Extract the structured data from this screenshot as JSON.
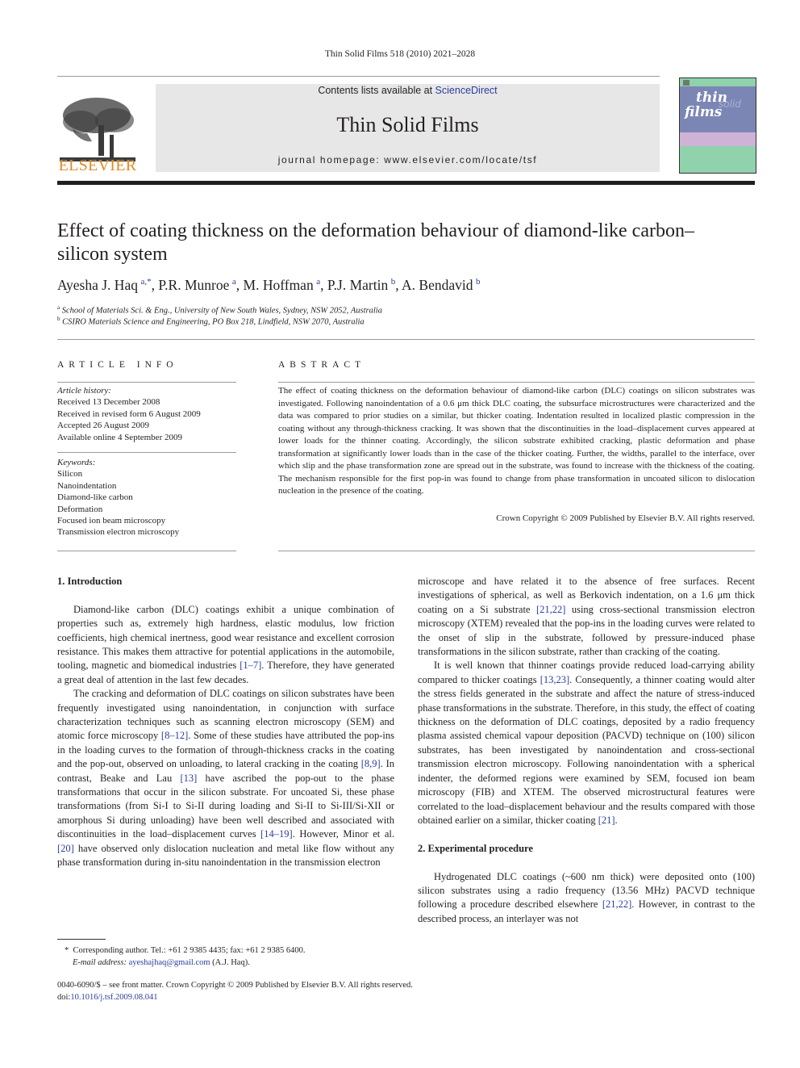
{
  "running_head": "Thin Solid Films 518 (2010) 2021–2028",
  "masthead": {
    "publisher_logo_text": "ELSEVIER",
    "contents_prefix": "Contents lists available at ",
    "contents_link": "ScienceDirect",
    "journal_name": "Thin Solid Films",
    "homepage": "journal homepage: www.elsevier.com/locate/tsf",
    "cover": {
      "word1": "thin",
      "word2": "solid",
      "word3": "films"
    }
  },
  "colors": {
    "link": "#2b3d9b",
    "elsevier_orange": "#e08b2a",
    "masthead_bg": "#e7e7e8",
    "cover_green": "#8fd2ac",
    "cover_blue": "#7c86b5",
    "cover_pink": "#cfb3d6"
  },
  "article": {
    "title": "Effect of coating thickness on the deformation behaviour of diamond-like carbon–silicon system",
    "authors": [
      {
        "name": "Ayesha J. Haq",
        "sup": "a,*"
      },
      {
        "name": "P.R. Munroe",
        "sup": "a"
      },
      {
        "name": "M. Hoffman",
        "sup": "a"
      },
      {
        "name": "P.J. Martin",
        "sup": "b"
      },
      {
        "name": "A. Bendavid",
        "sup": "b"
      }
    ],
    "affiliations": [
      {
        "sup": "a",
        "text": "School of Materials Sci. & Eng., University of New South Wales, Sydney, NSW 2052, Australia"
      },
      {
        "sup": "b",
        "text": "CSIRO Materials Science and Engineering, PO Box 218, Lindfield, NSW 2070, Australia"
      }
    ]
  },
  "article_info": {
    "heading": "ARTICLE INFO",
    "history_label": "Article history:",
    "history": [
      "Received 13 December 2008",
      "Received in revised form 6 August 2009",
      "Accepted 26 August 2009",
      "Available online 4 September 2009"
    ],
    "keywords_label": "Keywords:",
    "keywords": [
      "Silicon",
      "Nanoindentation",
      "Diamond-like carbon",
      "Deformation",
      "Focused ion beam microscopy",
      "Transmission electron microscopy"
    ]
  },
  "abstract": {
    "heading": "ABSTRACT",
    "text": "The effect of coating thickness on the deformation behaviour of diamond-like carbon (DLC) coatings on silicon substrates was investigated. Following nanoindentation of a 0.6 μm thick DLC coating, the subsurface microstructures were characterized and the data was compared to prior studies on a similar, but thicker coating. Indentation resulted in localized plastic compression in the coating without any through-thickness cracking. It was shown that the discontinuities in the load–displacement curves appeared at lower loads for the thinner coating. Accordingly, the silicon substrate exhibited cracking, plastic deformation and phase transformation at significantly lower loads than in the case of the thicker coating. Further, the widths, parallel to the interface, over which slip and the phase transformation zone are spread out in the substrate, was found to increase with the thickness of the coating. The mechanism responsible for the first pop-in was found to change from phase transformation in uncoated silicon to dislocation nucleation in the presence of the coating.",
    "copyright": "Crown Copyright © 2009 Published by Elsevier B.V. All rights reserved."
  },
  "body": {
    "sec1_heading": "1. Introduction",
    "p1": [
      "Diamond-like carbon (DLC) coatings exhibit a unique combination of properties such as, extremely high hardness, elastic modulus, low friction coefficients, high chemical inertness, good wear resistance and excellent corrosion resistance. This makes them attractive for potential applications in the automobile, tooling, magnetic and biomedical industries ",
      "[1–7]",
      ". Therefore, they have generated a great deal of attention in the last few decades."
    ],
    "p2": [
      "The cracking and deformation of DLC coatings on silicon substrates have been frequently investigated using nanoindentation, in conjunction with surface characterization techniques such as scanning electron microscopy (SEM) and atomic force microscopy ",
      "[8–12]",
      ". Some of these studies have attributed the pop-ins in the loading curves to the formation of through-thickness cracks in the coating and the pop-out, observed on unloading, to lateral cracking in the coating ",
      "[8,9]",
      ". In contrast, Beake and Lau ",
      "[13]",
      " have ascribed the pop-out to the phase transformations that occur in the silicon substrate. For uncoated Si, these phase transformations (from Si-I to Si-II during loading and Si-II to Si-III/Si-XII or amorphous Si during unloading) have been well described and associated with discontinuities in the load–displacement curves ",
      "[14–19]",
      ". However, Minor et al. ",
      "[20]",
      " have observed only dislocation nucleation and metal like flow without any phase transformation during in-situ nanoindentation in the transmission electron"
    ],
    "p2_cont": [
      "microscope and have related it to the absence of free surfaces. Recent investigations of spherical, as well as Berkovich indentation, on a 1.6 μm thick coating on a Si substrate ",
      "[21,22]",
      " using cross-sectional transmission electron microscopy (XTEM) revealed that the pop-ins in the loading curves were related to the onset of slip in the substrate, followed by pressure-induced phase transformations in the silicon substrate, rather than cracking of the coating."
    ],
    "p3": [
      "It is well known that thinner coatings provide reduced load-carrying ability compared to thicker coatings ",
      "[13,23]",
      ". Consequently, a thinner coating would alter the stress fields generated in the substrate and affect the nature of stress-induced phase transformations in the substrate. Therefore, in this study, the effect of coating thickness on the deformation of DLC coatings, deposited by a radio frequency plasma assisted chemical vapour deposition (PACVD) technique on (100) silicon substrates, has been investigated by nanoindentation and cross-sectional transmission electron microscopy. Following nanoindentation with a spherical indenter, the deformed regions were examined by SEM, focused ion beam microscopy (FIB) and XTEM. The observed microstructural features were correlated to the load–displacement behaviour and the results compared with those obtained earlier on a similar, thicker coating ",
      "[21]",
      "."
    ],
    "sec2_heading": "2. Experimental procedure",
    "p4": [
      "Hydrogenated DLC coatings (~600 nm thick) were deposited onto (100) silicon substrates using a radio frequency (13.56 MHz) PACVD technique following a procedure described elsewhere ",
      "[21,22]",
      ". However, in contrast to the described process, an interlayer was not"
    ]
  },
  "footnote": {
    "marker": "*",
    "corresponding": "Corresponding author. Tel.: +61 2 9385 4435; fax: +61 2 9385 6400.",
    "email_label": "E-mail address: ",
    "email": "ayeshajhaq@gmail.com",
    "email_suffix": " (A.J. Haq)."
  },
  "footer": {
    "issn_line": "0040-6090/$ – see front matter. Crown Copyright © 2009 Published by Elsevier B.V. All rights reserved.",
    "doi_prefix": "doi:",
    "doi": "10.1016/j.tsf.2009.08.041"
  }
}
